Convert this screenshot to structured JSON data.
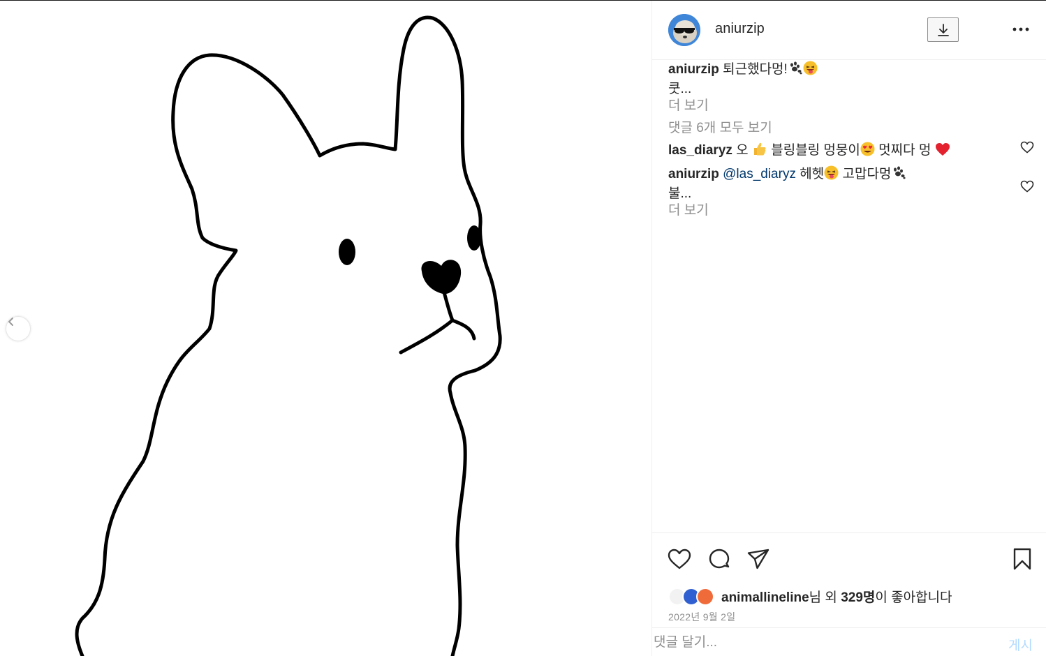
{
  "post": {
    "username": "aniurzip",
    "caption_user": "aniurzip",
    "caption_text": " 퇴근했다멍!",
    "caption_more_line": "쿳...",
    "see_more": "더 보기",
    "view_all_comments": "댓글 6개 모두 보기",
    "date": "2022년 9월 2일"
  },
  "comments": [
    {
      "user": "las_diaryz",
      "text_a": " 오 ",
      "text_b": " 블링블링 멍뭉이",
      "text_c": " 멋찌다 멍 "
    },
    {
      "user": "aniurzip",
      "mention": "@las_diaryz",
      "text_a": " 헤헷",
      "text_b": " 고맙다멍",
      "more_line": "불...",
      "see_more": "더 보기"
    }
  ],
  "likes": {
    "liker": "animallineline",
    "suffix_1": "님 외 ",
    "count": "329명",
    "suffix_2": "이 좋아합니다"
  },
  "comment_box": {
    "placeholder": "댓글 달기...",
    "post_label": "게시"
  },
  "colors": {
    "link": "#00376b",
    "muted": "#8e8e8e",
    "post_disabled": "#b3dbff"
  },
  "icons": [
    "chevron-left-icon",
    "download-icon",
    "more-icon",
    "heart-icon",
    "comment-icon",
    "share-icon",
    "bookmark-icon"
  ]
}
